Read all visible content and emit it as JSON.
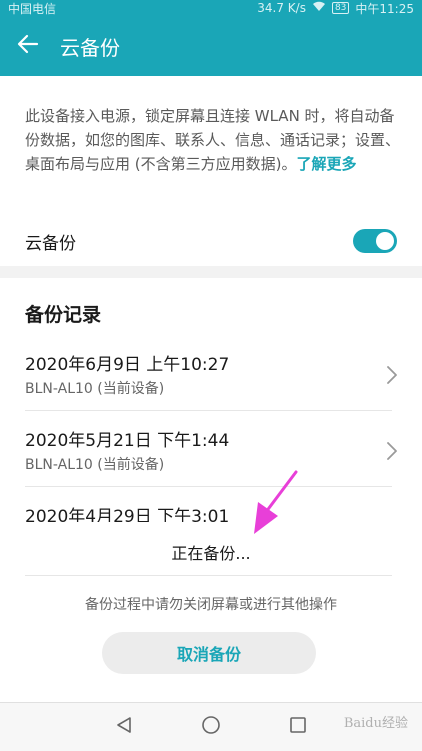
{
  "status_bar": {
    "carrier": "中国电信",
    "speed": "34.7 K/s",
    "battery": "83",
    "time": "中午11:25"
  },
  "header": {
    "title": "云备份",
    "back_icon": "arrow-left-icon"
  },
  "settings": {
    "description": "此设备接入电源，锁定屏幕且连接 WLAN 时，将自动备份数据，如您的图库、联系人、信息、通话记录；设置、桌面布局与应用 (不含第三方应用数据)。",
    "learn_more": "了解更多",
    "toggle_label": "云备份",
    "toggle_on": true
  },
  "records": {
    "title": "备份记录",
    "items": [
      {
        "date": "2020年6月9日 上午10:27",
        "device": "BLN-AL10 (当前设备)"
      },
      {
        "date": "2020年5月21日 下午1:44",
        "device": "BLN-AL10 (当前设备)"
      },
      {
        "date": "2020年4月29日 下午3:01",
        "device": ""
      }
    ]
  },
  "progress": {
    "status": "正在备份...",
    "hint": "备份过程中请勿关闭屏幕或进行其他操作",
    "cancel_label": "取消备份"
  },
  "watermark": "Baidu经验",
  "colors": {
    "accent": "#1aa6b7",
    "annotation_arrow": "#e83fd8"
  }
}
